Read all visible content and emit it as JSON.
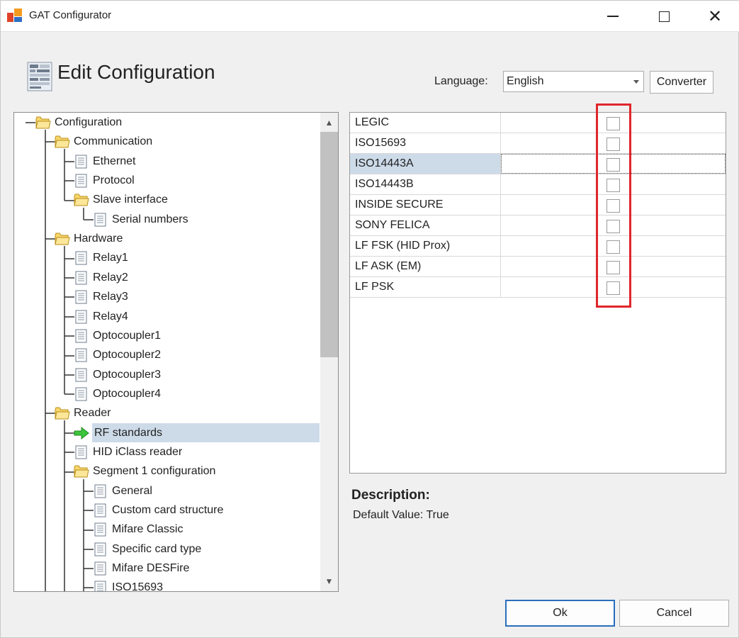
{
  "window": {
    "title": "GAT Configurator",
    "minimize_icon": "minimize-icon",
    "maximize_icon": "maximize-icon",
    "close_icon": "close-icon",
    "close_glyph": "✕"
  },
  "header": {
    "title": "Edit Configuration",
    "language_label": "Language:",
    "language_value": "English",
    "converter_label": "Converter"
  },
  "tree": {
    "nodes": [
      {
        "label": "Configuration",
        "icon": "folder-open-icon"
      },
      {
        "label": "Communication",
        "icon": "folder-open-icon"
      },
      {
        "label": "Ethernet",
        "icon": "document-icon"
      },
      {
        "label": "Protocol",
        "icon": "document-icon"
      },
      {
        "label": "Slave interface",
        "icon": "folder-open-icon"
      },
      {
        "label": "Serial numbers",
        "icon": "document-icon"
      },
      {
        "label": "Hardware",
        "icon": "folder-open-icon"
      },
      {
        "label": "Relay1",
        "icon": "document-icon"
      },
      {
        "label": "Relay2",
        "icon": "document-icon"
      },
      {
        "label": "Relay3",
        "icon": "document-icon"
      },
      {
        "label": "Relay4",
        "icon": "document-icon"
      },
      {
        "label": "Optocoupler1",
        "icon": "document-icon"
      },
      {
        "label": "Optocoupler2",
        "icon": "document-icon"
      },
      {
        "label": "Optocoupler3",
        "icon": "document-icon"
      },
      {
        "label": "Optocoupler4",
        "icon": "document-icon"
      },
      {
        "label": "Reader",
        "icon": "folder-open-icon"
      },
      {
        "label": "RF standards",
        "icon": "green-arrow-icon",
        "selected": true
      },
      {
        "label": "HID iClass reader",
        "icon": "document-icon"
      },
      {
        "label": "Segment 1 configuration",
        "icon": "folder-open-icon"
      },
      {
        "label": "General",
        "icon": "document-icon"
      },
      {
        "label": "Custom card structure",
        "icon": "document-icon"
      },
      {
        "label": "Mifare Classic",
        "icon": "document-icon"
      },
      {
        "label": "Specific card type",
        "icon": "document-icon"
      },
      {
        "label": "Mifare DESFire",
        "icon": "document-icon"
      },
      {
        "label": "ISO15693",
        "icon": "document-icon"
      }
    ]
  },
  "grid": {
    "rows": [
      {
        "name": "LEGIC",
        "checked": false
      },
      {
        "name": "ISO15693",
        "checked": false
      },
      {
        "name": "ISO14443A",
        "checked": false,
        "selected": true
      },
      {
        "name": "ISO14443B",
        "checked": false
      },
      {
        "name": "INSIDE SECURE",
        "checked": false
      },
      {
        "name": "SONY FELICA",
        "checked": false
      },
      {
        "name": "LF FSK (HID Prox)",
        "checked": false
      },
      {
        "name": "LF ASK (EM)",
        "checked": false
      },
      {
        "name": "LF PSK",
        "checked": false
      }
    ],
    "highlight_color": "#e0262b"
  },
  "description": {
    "title": "Description:",
    "text": "Default Value: True"
  },
  "footer": {
    "ok_label": "Ok",
    "cancel_label": "Cancel"
  },
  "colors": {
    "selection": "#cddbe9",
    "ok_border": "#2a6ebc",
    "folder": "#f2c94c"
  }
}
